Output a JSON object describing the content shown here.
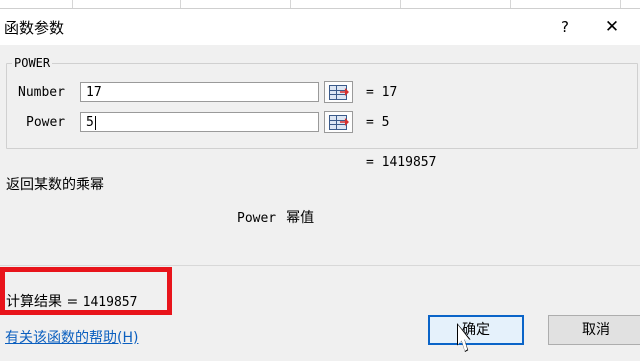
{
  "dialog": {
    "title": "函数参数",
    "help_button": "?",
    "close_button": "✕"
  },
  "function": {
    "name": "POWER",
    "args": [
      {
        "label": "Number",
        "value": "17",
        "evaluated": "= 17"
      },
      {
        "label": "Power",
        "value": "5",
        "evaluated": "= 5"
      }
    ],
    "result_preview": "= 1419857",
    "description": "返回某数的乘幂",
    "param_name": "Power",
    "param_description": "幂值"
  },
  "footer": {
    "calc_result_label": "计算结果 =",
    "calc_result_value": "1419857",
    "help_link": "有关该函数的帮助(H)",
    "ok_label": "确定",
    "cancel_label": "取消"
  },
  "icons": {
    "ref_button_icon": "collapse-dialog-icon",
    "cursor": "mouse-pointer-icon"
  },
  "colors": {
    "highlight": "#e8141b",
    "link": "#0b5fbf",
    "ok_border": "#0a64c8"
  }
}
